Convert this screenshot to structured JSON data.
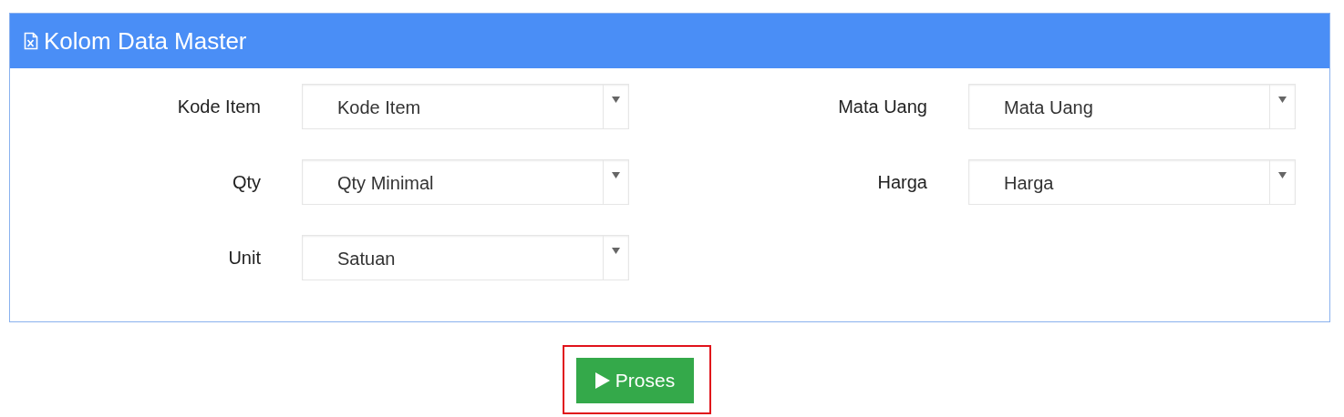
{
  "panel": {
    "title": "Kolom Data Master"
  },
  "form_rows": [
    [
      {
        "label": "Kode Item",
        "value": "Kode Item"
      },
      {
        "label": "Mata Uang",
        "value": "Mata Uang"
      }
    ],
    [
      {
        "label": "Qty",
        "value": "Qty Minimal"
      },
      {
        "label": "Harga",
        "value": "Harga"
      }
    ],
    [
      {
        "label": "Unit",
        "value": "Satuan"
      }
    ]
  ],
  "button": {
    "label": "Proses",
    "highlighted": true
  }
}
